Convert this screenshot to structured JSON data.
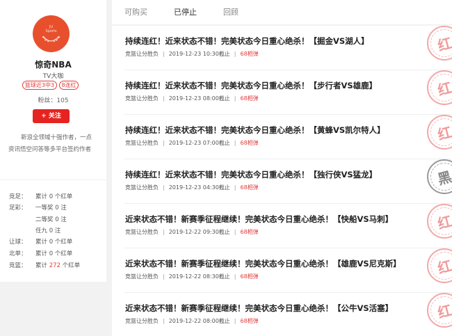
{
  "profile": {
    "avatar_text": [
      "JU",
      "Sports"
    ],
    "name": "惊奇NBA",
    "subtitle": "TV大咖",
    "tags": [
      "篮球近3中3",
      "8连红"
    ],
    "fans": "粉丝：105",
    "follow_label": "+ 关注",
    "bio": "新浪全领域十强作者，一点资讯悟空问答等多平台签约作者"
  },
  "stats": [
    {
      "label": "竞足：",
      "value": "累计 0 个红单"
    },
    {
      "label": "足彩：",
      "value": "一等奖 0 注"
    },
    {
      "label": "",
      "value": "二等奖 0 注"
    },
    {
      "label": "",
      "value": "任九 0 注"
    },
    {
      "label": "让球：",
      "value": "累计 0 个红单"
    },
    {
      "label": "北单：",
      "value": "累计 0 个红单"
    },
    {
      "label": "竞篮：",
      "value_pre": "累计 ",
      "value_hl": "272",
      "value_post": " 个红单"
    }
  ],
  "tabs": [
    "可购买",
    "已停止",
    "回顾"
  ],
  "active_tab": 1,
  "colors": {
    "accent": "#e23d3d",
    "follow_button": "#e52421",
    "avatar": "#e8502d"
  },
  "items": [
    {
      "title": "持续连红！近来状态不错！完美状态今日重心绝杀！【掘金VS湖人】",
      "type": "竞篮让分胜负",
      "time": "2019-12-23 10:30截止",
      "price": "68相弹",
      "stamp": "红",
      "stamp_color": "red"
    },
    {
      "title": "持续连红！近来状态不错！完美状态今日重心绝杀！【步行者VS雄鹿】",
      "type": "竞篮让分胜负",
      "time": "2019-12-23 08:00截止",
      "price": "68相弹",
      "stamp": "红",
      "stamp_color": "red"
    },
    {
      "title": "持续连红！近来状态不错！完美状态今日重心绝杀！【黄蜂VS凯尔特人】",
      "type": "竞篮让分胜负",
      "time": "2019-12-23 07:00截止",
      "price": "68相弹",
      "stamp": "红",
      "stamp_color": "red"
    },
    {
      "title": "持续连红！近来状态不错！完美状态今日重心绝杀！【独行侠VS猛龙】",
      "type": "竞篮让分胜负",
      "time": "2019-12-23 04:30截止",
      "price": "68相弹",
      "stamp": "黑",
      "stamp_color": "black"
    },
    {
      "title": "近来状态不错！新赛季征程继续！完美状态今日重心绝杀！【快船VS马刺】",
      "type": "竞篮让分胜负",
      "time": "2019-12-22 09:30截止",
      "price": "68相弹",
      "stamp": "红",
      "stamp_color": "red"
    },
    {
      "title": "近来状态不错！新赛季征程继续！完美状态今日重心绝杀！【雄鹿VS尼克斯】",
      "type": "竞篮让分胜负",
      "time": "2019-12-22 08:30截止",
      "price": "68相弹",
      "stamp": "红",
      "stamp_color": "red"
    },
    {
      "title": "近来状态不错！新赛季征程继续！完美状态今日重心绝杀！【公牛VS活塞】",
      "type": "竞篮让分胜负",
      "time": "2019-12-22 08:00截止",
      "price": "68相弹",
      "stamp": "红",
      "stamp_color": "red"
    }
  ]
}
